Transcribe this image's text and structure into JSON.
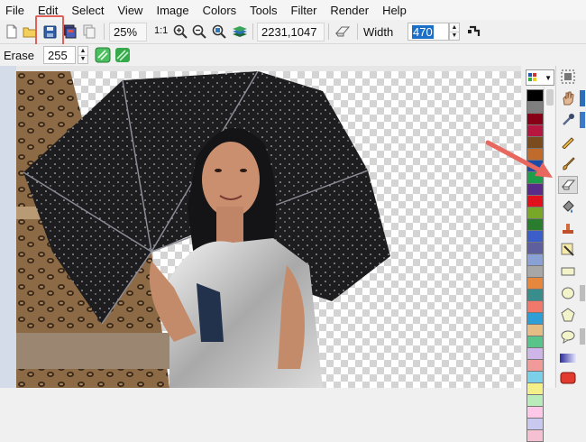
{
  "menu": [
    "File",
    "Edit",
    "Select",
    "View",
    "Image",
    "Colors",
    "Tools",
    "Filter",
    "Render",
    "Help"
  ],
  "toolbar": {
    "zoom_value": "25%",
    "one_to_one": "1:1",
    "coordinates": "2231,1047",
    "width_label": "Width",
    "width_value": "470"
  },
  "options_bar": {
    "tool_label": "Erase",
    "erase_value": "255"
  },
  "palette_colors": [
    "#000000",
    "#7f7f7f",
    "#880015",
    "#b5173e",
    "#7a4b1e",
    "#c06a2b",
    "#1e4aa8",
    "#1d9c4a",
    "#5a2c8a",
    "#e0101c",
    "#79a829",
    "#2a7c2e",
    "#3b5ec9",
    "#5f5f9e",
    "#8aa1d6",
    "#a7a7a7",
    "#e6873e",
    "#3a8d8d",
    "#f0796b",
    "#2e9ed6",
    "#e4bd85",
    "#58c48a",
    "#d0b6e8",
    "#f09a9a",
    "#7ad0e8",
    "#f3f08a",
    "#b9ecba",
    "#ffc8e8",
    "#c9c9f0",
    "#f5c1d2"
  ],
  "colors": {
    "highlight": "#e0605a",
    "arrow": "#e8675e",
    "width_selected_bg": "#1c6fc6"
  },
  "icons": {
    "new": "new-file-icon",
    "open": "open-folder-icon",
    "save": "save-icon",
    "zoom_in": "zoom-in-icon",
    "zoom_out": "zoom-out-icon",
    "eraser": "eraser-icon"
  }
}
